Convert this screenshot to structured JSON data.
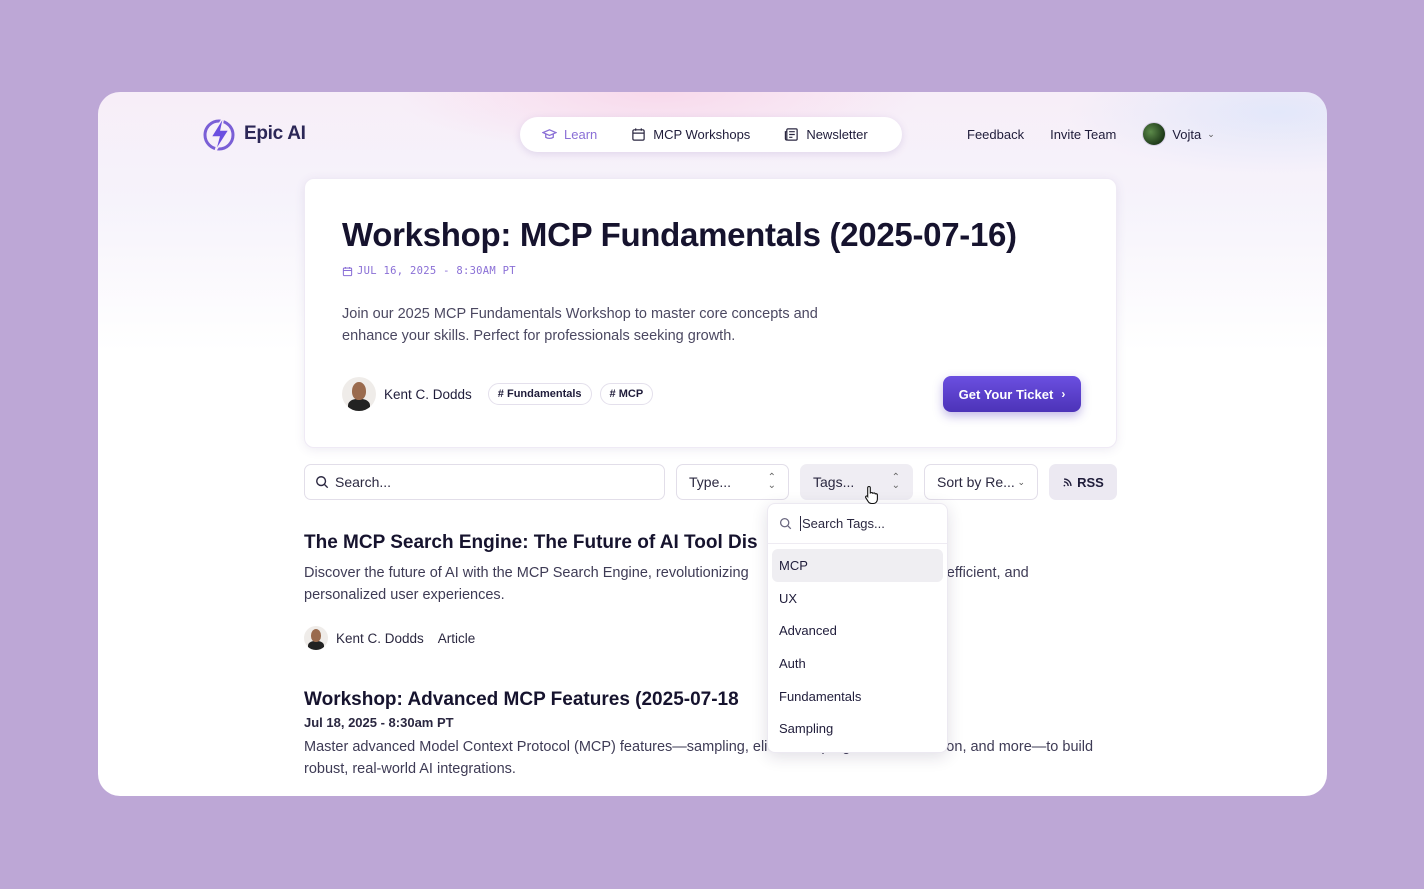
{
  "brand": {
    "name": "Epic AI",
    "accent": "#8a6fd6",
    "button": "#5a3fcc"
  },
  "nav": {
    "items": [
      {
        "label": "Learn",
        "icon": "graduation-cap-icon",
        "active": true
      },
      {
        "label": "MCP Workshops",
        "icon": "calendar-icon"
      },
      {
        "label": "Newsletter",
        "icon": "newspaper-icon"
      }
    ]
  },
  "header": {
    "feedback": "Feedback",
    "invite": "Invite Team",
    "user": "Vojta"
  },
  "hero": {
    "title": "Workshop: MCP Fundamentals (2025-07-16)",
    "date": "JUL 16, 2025 - 8:30AM PT",
    "description": "Join our 2025 MCP Fundamentals Workshop to master core concepts and enhance your skills. Perfect for professionals seeking growth.",
    "author": "Kent C. Dodds",
    "tags": [
      "# Fundamentals",
      "# MCP"
    ],
    "cta": "Get Your Ticket"
  },
  "filters": {
    "search_placeholder": "Search...",
    "type": "Type...",
    "tags": "Tags...",
    "sort": "Sort by Re...",
    "rss": "RSS"
  },
  "tags_dropdown": {
    "placeholder": "Search Tags...",
    "options": [
      "MCP",
      "UX",
      "Advanced",
      "Auth",
      "Fundamentals",
      "Sampling"
    ],
    "highlighted": "MCP"
  },
  "list": [
    {
      "title": "The MCP Search Engine: The Future of AI Tool Dis",
      "description": "Discover the future of AI with the MCP Search Engine, revolutionizing",
      "description_tail": ", efficient, and",
      "description_line2": "personalized user experiences.",
      "author": "Kent C. Dodds",
      "type": "Article"
    },
    {
      "title": "Workshop: Advanced MCP Features (2025-07-18",
      "date": "Jul 18, 2025 - 8:30am PT",
      "description": "Master advanced Model Context Protocol (MCP) features—sampling, elicitation, progress, cancellation, and more—to build robust, real-world AI integrations."
    }
  ]
}
